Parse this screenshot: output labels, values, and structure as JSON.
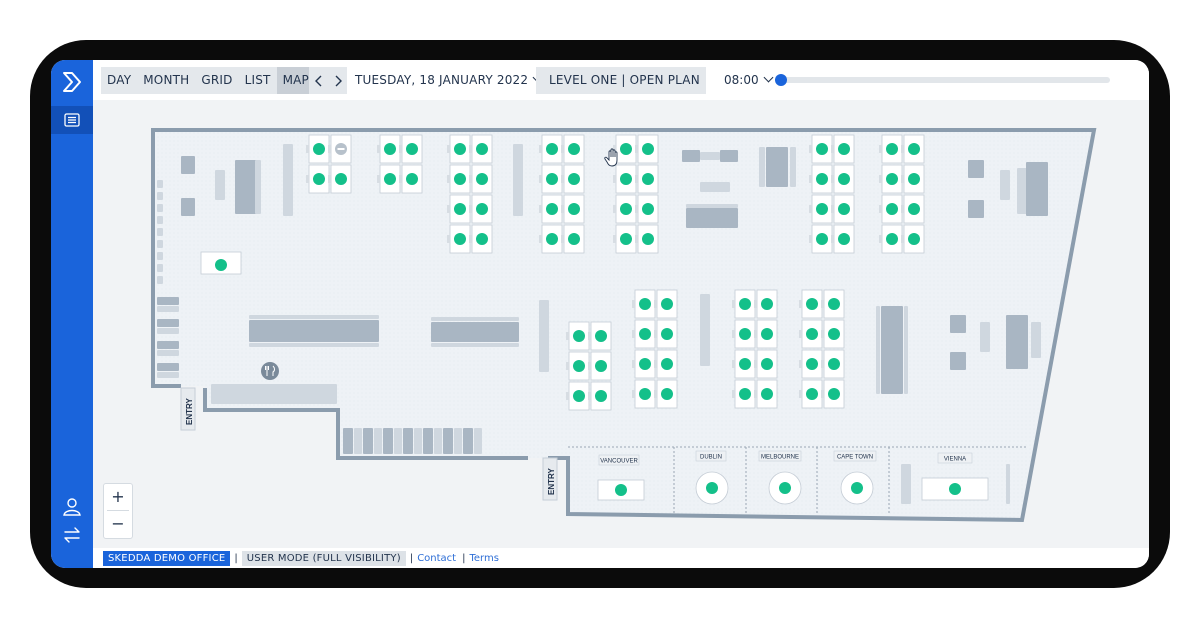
{
  "toolbar": {
    "views": [
      "DAY",
      "MONTH",
      "GRID",
      "LIST",
      "MAP"
    ],
    "active_view": "MAP",
    "date": "TUESDAY, 18 JANUARY 2022",
    "floor": "LEVEL ONE | OPEN PLAN",
    "time": "08:00",
    "time_progress": 0.0
  },
  "map": {
    "entries": [
      "ENTRY",
      "ENTRY"
    ],
    "rooms": [
      "VANCOUVER",
      "DUBLIN",
      "MELBOURNE",
      "CAPE TOWN",
      "VIENNA"
    ]
  },
  "footer": {
    "office": "SKEDDA DEMO OFFICE",
    "mode": "USER MODE (FULL VISIBILITY)",
    "contact": "Contact",
    "terms": "Terms"
  },
  "colors": {
    "brand": "#1a64db",
    "available": "#14c08a",
    "wall": "#8b9cad"
  },
  "icons": [
    "logo-icon",
    "list-icon",
    "user-icon",
    "swap-icon",
    "hand-cursor-icon",
    "restaurant-icon",
    "unavailable-icon"
  ]
}
